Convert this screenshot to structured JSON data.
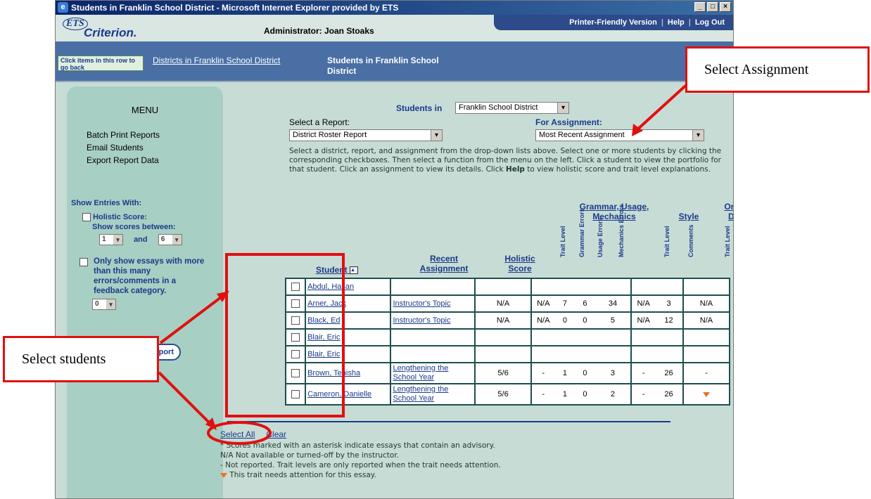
{
  "window": {
    "title": "Students in Franklin School District - Microsoft Internet Explorer provided by ETS",
    "min": "_",
    "max": "□",
    "close": "×"
  },
  "header": {
    "logo_mark": "ETS",
    "logo_name": "Criterion.",
    "admin": "Administrator: Joan Stoaks",
    "links": [
      "Printer-Friendly Version",
      "Help",
      "Log Out"
    ]
  },
  "breadcrumb": {
    "tip": "Click items in this row to go back",
    "link": "Districts in Franklin School District",
    "current": "Students in Franklin School District"
  },
  "menu": {
    "title": "MENU",
    "items": [
      "Batch Print Reports",
      "Email Students",
      "Export Report Data"
    ],
    "show_entries": "Show Entries With:",
    "holistic": "Holistic Score:",
    "between": "Show scores between:",
    "low": "1",
    "and": "and",
    "high": "6",
    "only_show": "Only show essays with more than this many errors/comments in a feedback category.",
    "count": "0",
    "report_btn": "port"
  },
  "main": {
    "students_in": "Students in",
    "district": "Franklin School District",
    "select_report_label": "Select a Report:",
    "report": "District Roster Report",
    "for_assignment_label": "For Assignment:",
    "assignment": "Most Recent Assignment",
    "description_a": "Select a district, report, and assignment from the drop-down lists above. Select one or more students by clicking the corresponding checkboxes. Then select a function from the menu on the left. Click a student to view the portfolio for that student. Click an assignment to view its details. Click ",
    "description_help": "Help",
    "description_b": " to view holistic score and trait level explanations."
  },
  "columns": {
    "student": "Student",
    "recent": "Recent Assignment",
    "holistic": "Holistic Score",
    "gum": "Grammar, Usage, Mechanics",
    "style": "Style",
    "orgdev": "Org & Dev",
    "trait": "Trait Level",
    "grammar": "Grammar Errors",
    "usage": "Usage Errors",
    "mechanics": "Mechanics Errors",
    "comments": "Comments"
  },
  "rows": [
    {
      "name": "Abdul, Hasan",
      "assign": "",
      "score": "",
      "t1": "",
      "g": "",
      "u": "",
      "m": "",
      "t2": "",
      "c": "",
      "t3": ""
    },
    {
      "name": "Arner, Jack",
      "assign": "Instructor's Topic",
      "score": "N/A",
      "t1": "N/A",
      "g": "7",
      "u": "6",
      "m": "34",
      "t2": "N/A",
      "c": "3",
      "t3": "N/A"
    },
    {
      "name": "Black, Ed",
      "assign": "Instructor's Topic",
      "score": "N/A",
      "t1": "N/A",
      "g": "0",
      "u": "0",
      "m": "5",
      "t2": "N/A",
      "c": "12",
      "t3": "N/A"
    },
    {
      "name": "Blair, Eric",
      "assign": "",
      "score": "",
      "t1": "",
      "g": "",
      "u": "",
      "m": "",
      "t2": "",
      "c": "",
      "t3": ""
    },
    {
      "name": "Blair, Eric",
      "assign": "",
      "score": "",
      "t1": "",
      "g": "",
      "u": "",
      "m": "",
      "t2": "",
      "c": "",
      "t3": ""
    },
    {
      "name": "Brown, Tenisha",
      "assign": "Lengthening the School Year",
      "score": "5/6",
      "t1": "-",
      "g": "1",
      "u": "0",
      "m": "3",
      "t2": "-",
      "c": "26",
      "t3": "-"
    },
    {
      "name": "Cameron, Danielle",
      "assign": "Lengthening the School Year",
      "score": "5/6",
      "t1": "-",
      "g": "1",
      "u": "0",
      "m": "2",
      "t2": "-",
      "c": "26",
      "t3": "▼"
    }
  ],
  "footer": {
    "select_all": "Select All",
    "clear": "Clear",
    "legend": [
      "* Scores marked with an asterisk indicate essays that contain an advisory.",
      "N/A Not available or turned-off by the instructor.",
      "- Not reported. Trait levels are only reported when the trait needs attention.",
      "This trait needs attention for this essay."
    ]
  },
  "annotations": {
    "select_assignment": "Select Assignment",
    "select_students": "Select students",
    "color": "#e01010"
  }
}
